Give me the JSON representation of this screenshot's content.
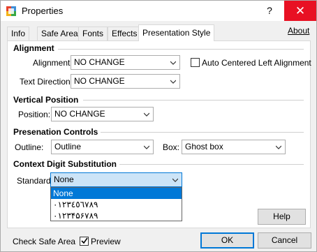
{
  "window": {
    "title": "Properties",
    "help_label": "?",
    "close_label": "✕"
  },
  "tabs": [
    {
      "label": "Info",
      "active": false
    },
    {
      "label": "Safe Area",
      "active": false
    },
    {
      "label": "Fonts",
      "active": false
    },
    {
      "label": "Effects",
      "active": false
    },
    {
      "label": "Presentation Style",
      "active": true
    }
  ],
  "about_label": "About",
  "alignment": {
    "title": "Alignment",
    "alignment_label": "Alignment:",
    "alignment_value": "NO CHANGE",
    "auto_center_label": "Auto Centered Left Alignment",
    "auto_center_checked": false,
    "text_direction_label": "Text Direction:",
    "text_direction_value": "NO CHANGE"
  },
  "vertical_position": {
    "title": "Vertical Position",
    "position_label": "Position:",
    "position_value": "NO CHANGE"
  },
  "presentation_controls": {
    "title": "Presenation Controls",
    "outline_label": "Outline:",
    "outline_value": "Outline",
    "box_label": "Box:",
    "box_value": "Ghost box"
  },
  "context_digit": {
    "title": "Context Digit Substitution",
    "standard_label": "Standard",
    "standard_value": "None",
    "options": [
      "None",
      "٠١٢٣٤٥٦٧٨٩",
      "۰۱۲۳۴۵۶۷۸۹"
    ]
  },
  "footer": {
    "help_button": "Help",
    "check_safe_area_label": "Check Safe Area",
    "preview_label": "Preview",
    "preview_checked": true,
    "ok_button": "OK",
    "cancel_button": "Cancel"
  },
  "colors": {
    "accent": "#0078d7",
    "close_red": "#e81123",
    "selection_bg": "#cce4f7"
  }
}
